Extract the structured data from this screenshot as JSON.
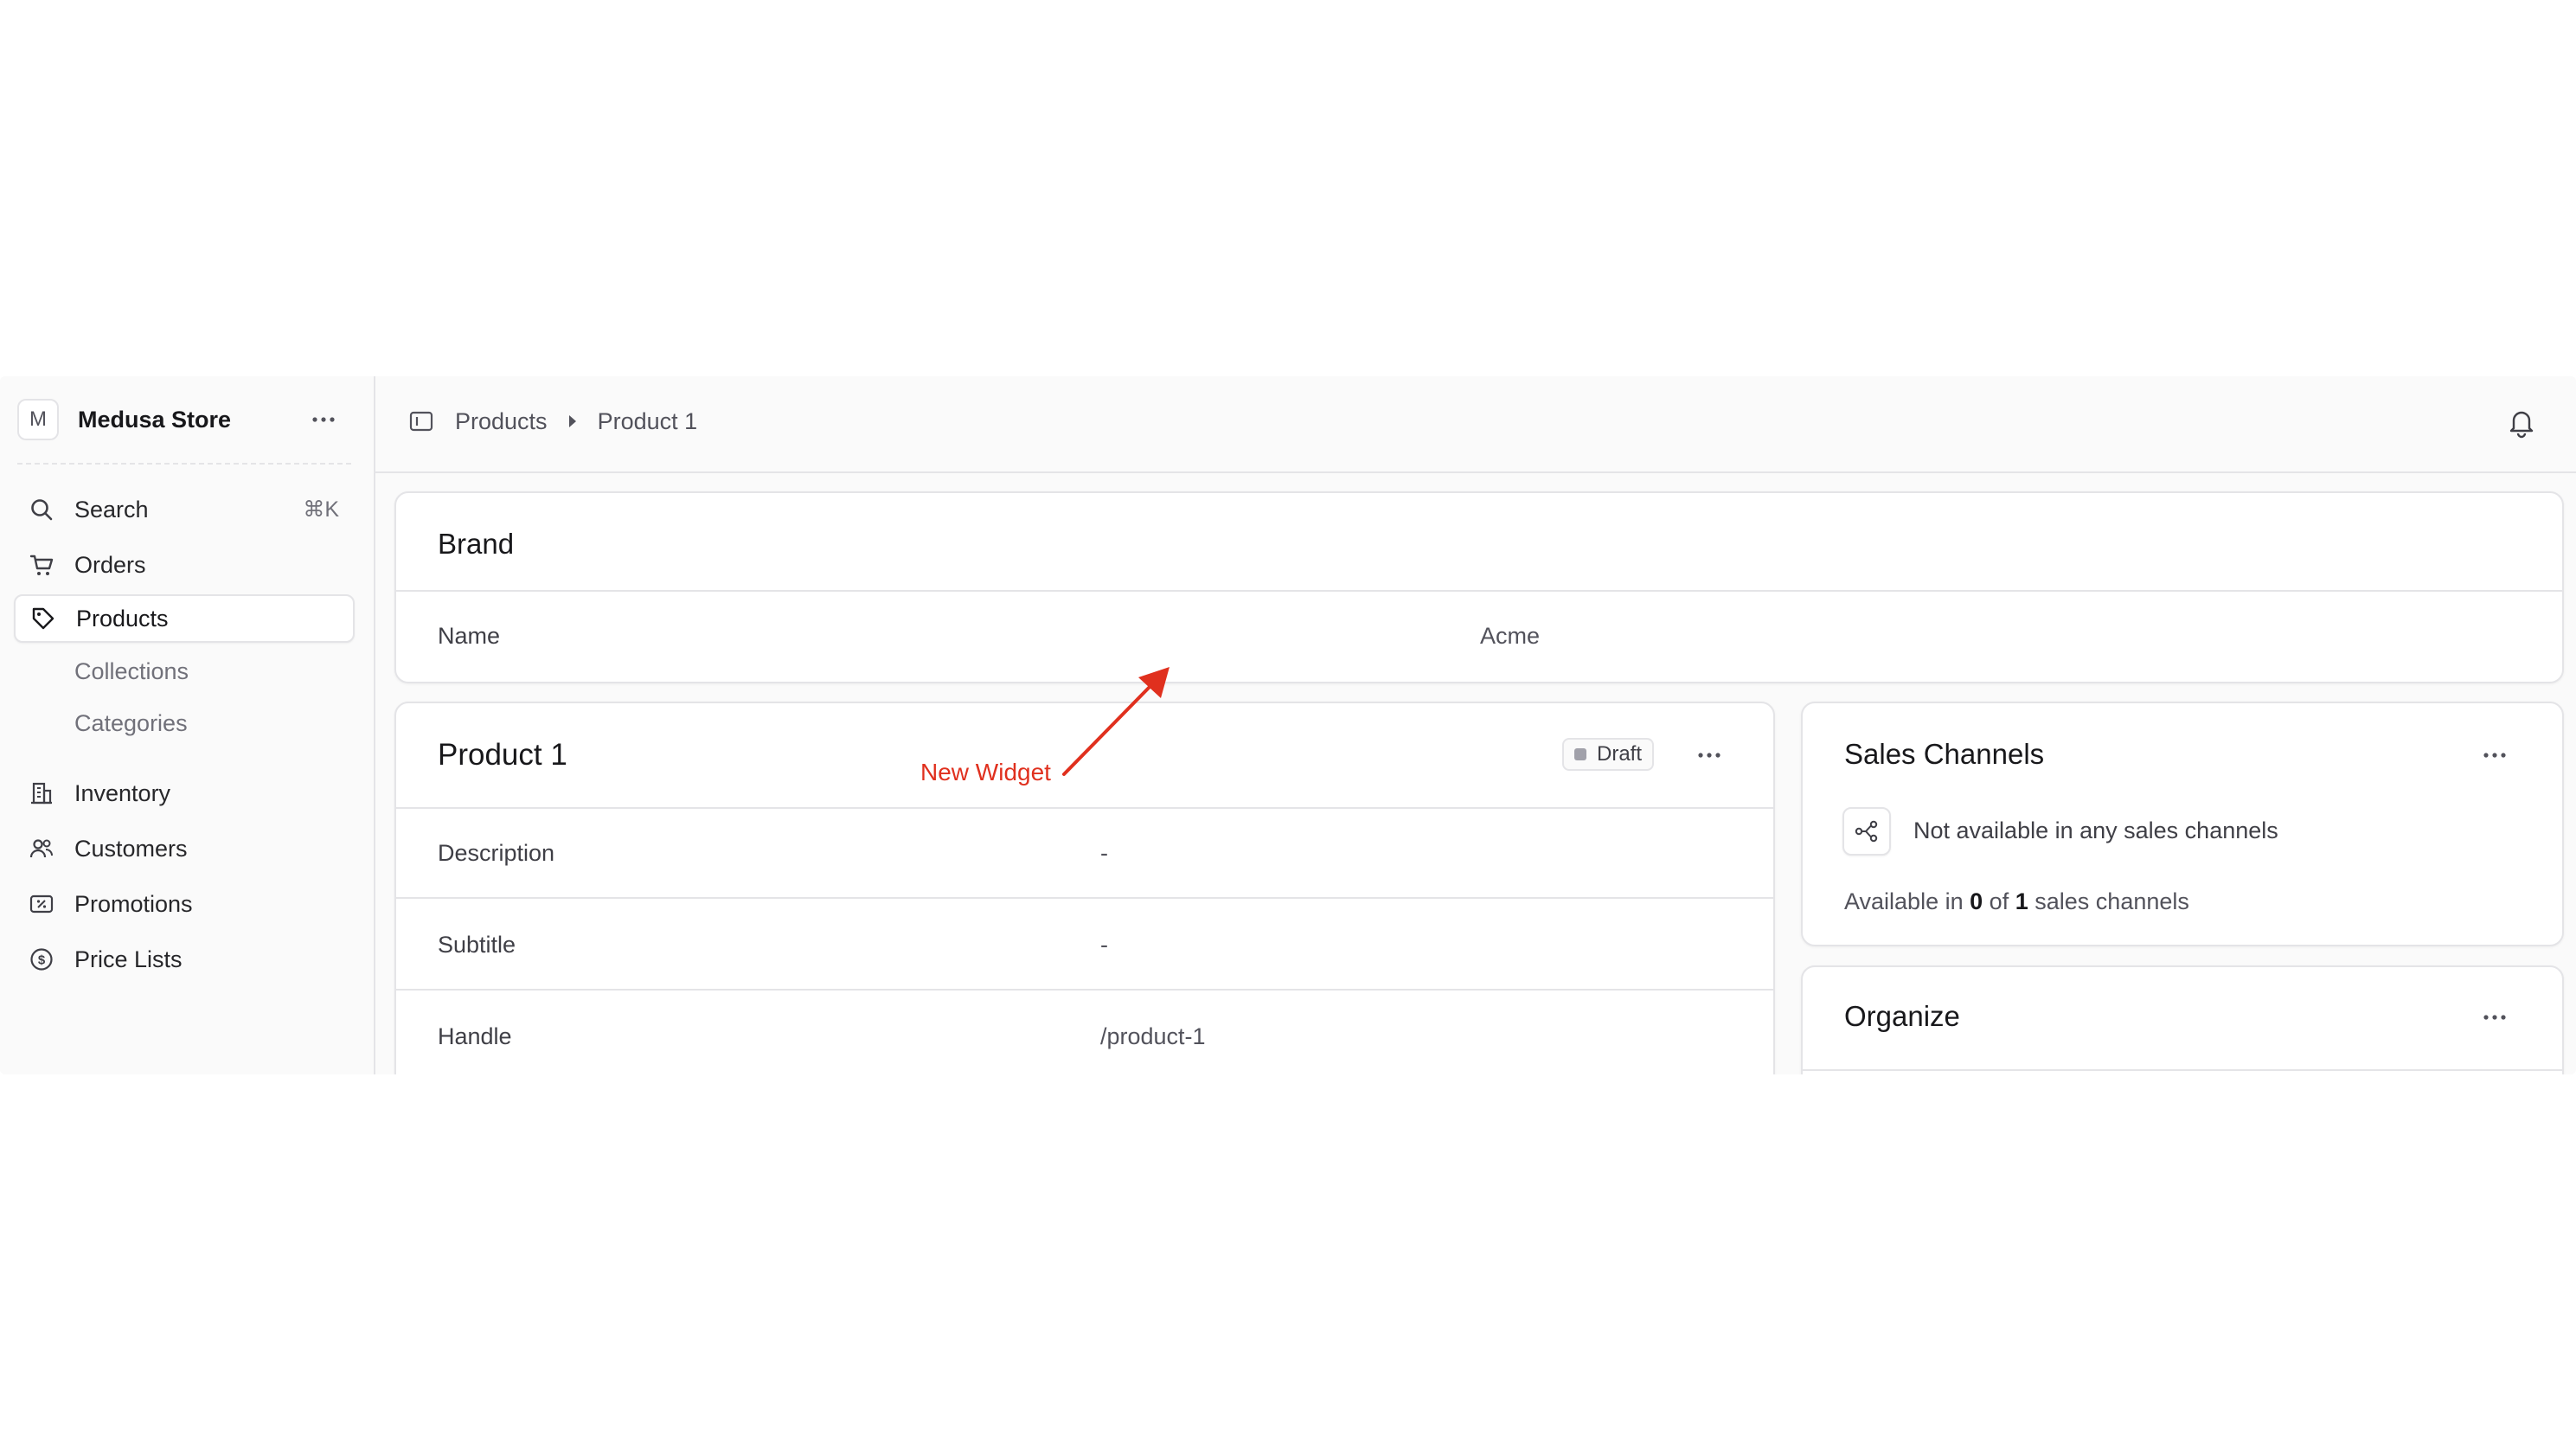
{
  "sidebar": {
    "store_initial": "M",
    "store_name": "Medusa Store",
    "search_label": "Search",
    "search_shortcut": "⌘K",
    "items": [
      {
        "label": "Orders",
        "icon": "cart-icon"
      },
      {
        "label": "Products",
        "icon": "tag-icon",
        "active": true
      },
      {
        "label": "Inventory",
        "icon": "building-icon"
      },
      {
        "label": "Customers",
        "icon": "users-icon"
      },
      {
        "label": "Promotions",
        "icon": "receipt-percent-icon"
      },
      {
        "label": "Price Lists",
        "icon": "currency-dollar-icon"
      }
    ],
    "product_subitems": [
      "Collections",
      "Categories"
    ]
  },
  "header": {
    "breadcrumb": [
      "Products",
      "Product 1"
    ]
  },
  "brand_widget": {
    "title": "Brand",
    "rows": [
      {
        "label": "Name",
        "value": "Acme"
      }
    ]
  },
  "annotation": {
    "text": "New Widget",
    "color": "#e0301e"
  },
  "product": {
    "title": "Product 1",
    "status": "Draft",
    "rows": [
      {
        "label": "Description",
        "value": "-"
      },
      {
        "label": "Subtitle",
        "value": "-"
      },
      {
        "label": "Handle",
        "value": "/product-1"
      }
    ]
  },
  "sales_channels": {
    "title": "Sales Channels",
    "empty_text": "Not available in any sales channels",
    "available_prefix": "Available in",
    "available_count": "0",
    "of_text": "of",
    "total_count": "1",
    "suffix": "sales channels"
  },
  "organize": {
    "title": "Organize"
  }
}
